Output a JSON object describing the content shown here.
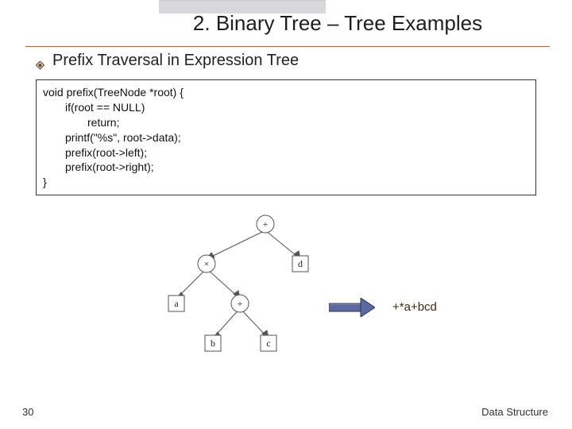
{
  "title": "2. Binary Tree – Tree Examples",
  "subtitle": "Prefix Traversal in Expression Tree",
  "code": {
    "l1": "void prefix(TreeNode *root) {",
    "l2": "if(root == NULL)",
    "l3": "return;",
    "l4": "printf(\"%s\", root->data);",
    "l5": "prefix(root->left);",
    "l6": "prefix(root->right);",
    "l7": "}"
  },
  "tree": {
    "nodes": {
      "root": "+",
      "l": "×",
      "r": "d",
      "ll": "a",
      "lr": "+",
      "lrl": "b",
      "lrr": "c"
    }
  },
  "result": "+*a+bcd",
  "page_no": "30",
  "footer": "Data Structure"
}
